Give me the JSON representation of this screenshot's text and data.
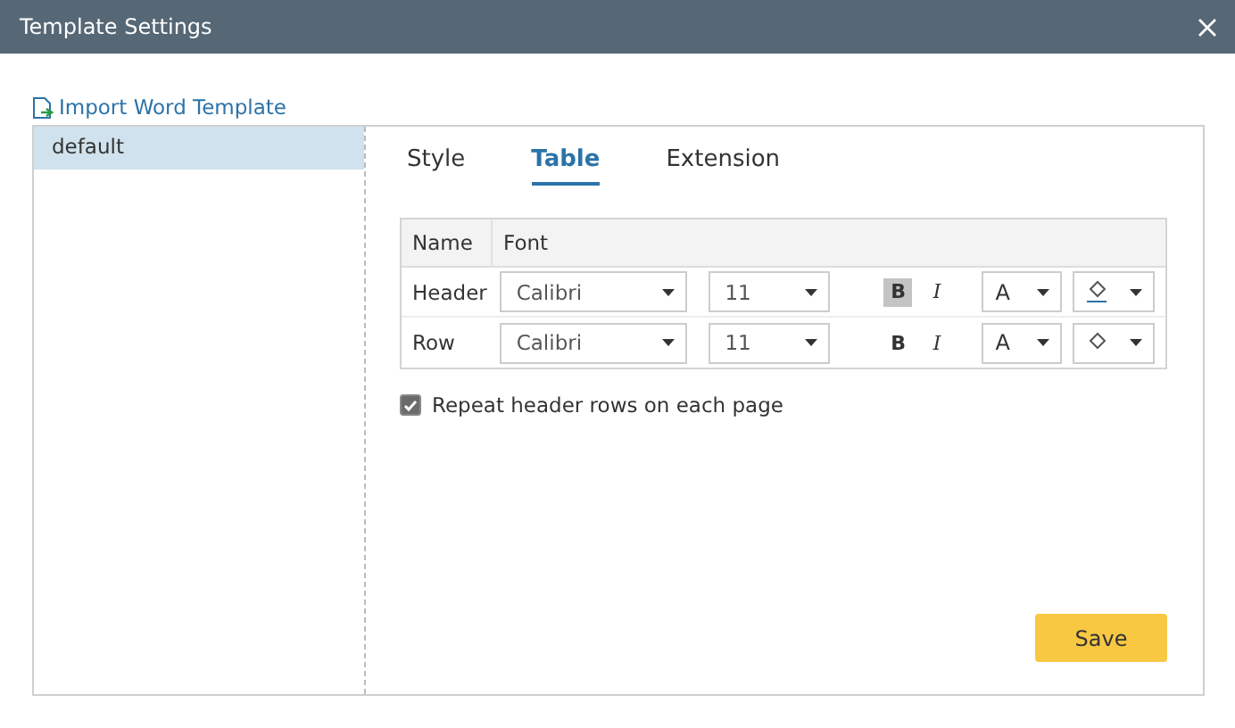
{
  "window": {
    "title": "Template Settings"
  },
  "import_link": "Import Word Template",
  "templates": [
    {
      "name": "default",
      "selected": true
    }
  ],
  "tabs": [
    {
      "label": "Style",
      "selected": false
    },
    {
      "label": "Table",
      "selected": true
    },
    {
      "label": "Extension",
      "selected": false
    }
  ],
  "table": {
    "columns": [
      "Name",
      "Font"
    ],
    "rows": [
      {
        "name": "Header",
        "font": "Calibri",
        "size": "11",
        "bold_label": "B",
        "bold": true,
        "italic_label": "I",
        "italic": false,
        "color_label": "A",
        "fill_underline": true
      },
      {
        "name": "Row",
        "font": "Calibri",
        "size": "11",
        "bold_label": "B",
        "bold": false,
        "italic_label": "I",
        "italic": false,
        "color_label": "A",
        "fill_underline": false
      }
    ]
  },
  "repeat_header": {
    "label": "Repeat header rows on each page",
    "checked": true
  },
  "save_button": "Save"
}
